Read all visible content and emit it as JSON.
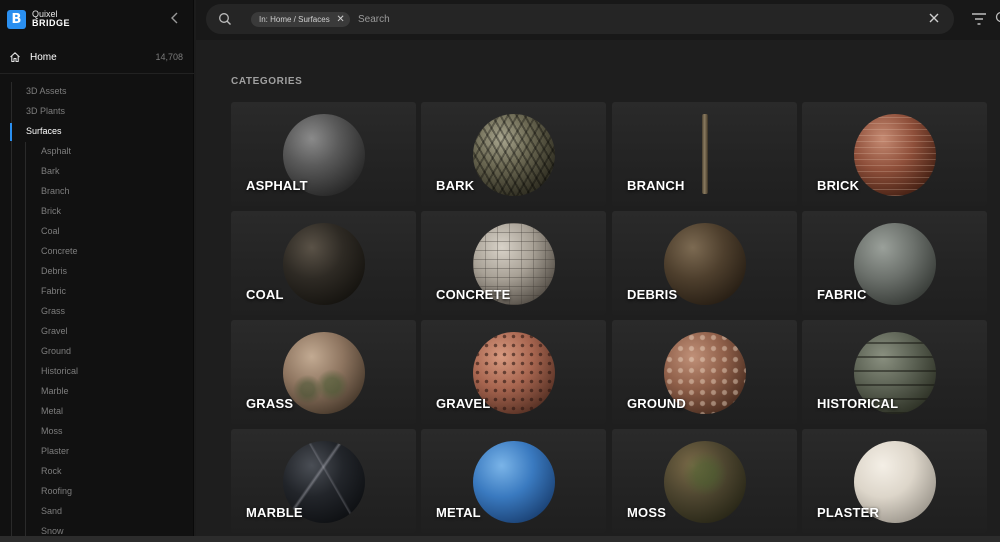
{
  "brand": {
    "top": "Quixel",
    "bottom": "BRIDGE",
    "logo_letter": "B",
    "accent": "#2a8ff0"
  },
  "sidebar": {
    "home": {
      "label": "Home",
      "count": "14,708"
    },
    "top_items": [
      {
        "label": "3D Assets"
      },
      {
        "label": "3D Plants"
      },
      {
        "label": "Surfaces"
      }
    ],
    "sub_items": [
      {
        "label": "Asphalt"
      },
      {
        "label": "Bark"
      },
      {
        "label": "Branch"
      },
      {
        "label": "Brick"
      },
      {
        "label": "Coal"
      },
      {
        "label": "Concrete"
      },
      {
        "label": "Debris"
      },
      {
        "label": "Fabric"
      },
      {
        "label": "Grass"
      },
      {
        "label": "Gravel"
      },
      {
        "label": "Ground"
      },
      {
        "label": "Historical"
      },
      {
        "label": "Marble"
      },
      {
        "label": "Metal"
      },
      {
        "label": "Moss"
      },
      {
        "label": "Plaster"
      },
      {
        "label": "Rock"
      },
      {
        "label": "Roofing"
      },
      {
        "label": "Sand"
      },
      {
        "label": "Snow"
      }
    ]
  },
  "search": {
    "chip": "In: Home / Surfaces",
    "placeholder": "Search",
    "value": ""
  },
  "main": {
    "section_title": "CATEGORIES",
    "categories": [
      {
        "label": "ASPHALT"
      },
      {
        "label": "BARK"
      },
      {
        "label": "BRANCH"
      },
      {
        "label": "BRICK"
      },
      {
        "label": "COAL"
      },
      {
        "label": "CONCRETE"
      },
      {
        "label": "DEBRIS"
      },
      {
        "label": "FABRIC"
      },
      {
        "label": "GRASS"
      },
      {
        "label": "GRAVEL"
      },
      {
        "label": "GROUND"
      },
      {
        "label": "HISTORICAL"
      },
      {
        "label": "MARBLE"
      },
      {
        "label": "METAL"
      },
      {
        "label": "MOSS"
      },
      {
        "label": "PLASTER"
      }
    ]
  }
}
